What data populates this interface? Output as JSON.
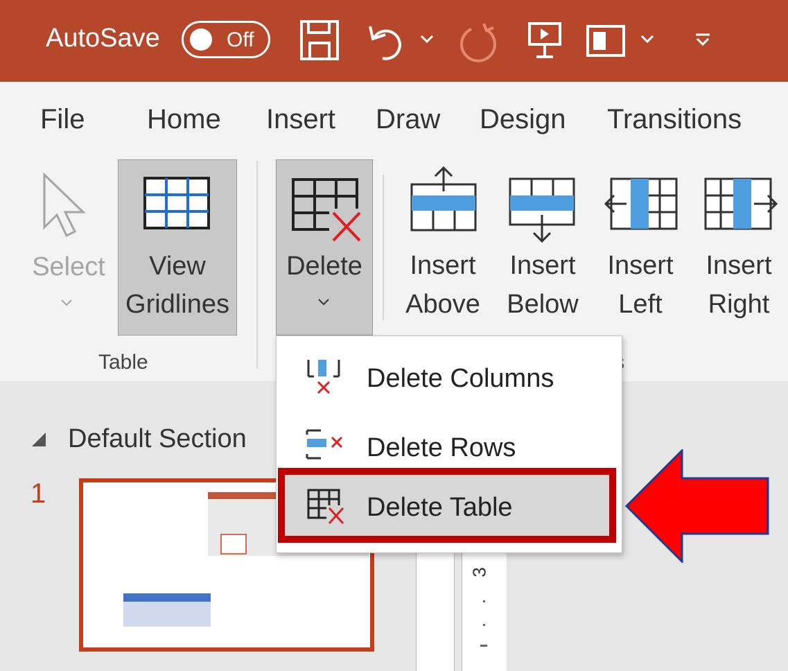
{
  "titlebar": {
    "autosave_label": "AutoSave",
    "autosave_state": "Off",
    "icons": [
      "save-icon",
      "undo-icon",
      "redo-icon",
      "present-icon",
      "layout-icon",
      "customize-icon"
    ],
    "background": "#b7472a"
  },
  "tabs": [
    "File",
    "Home",
    "Insert",
    "Draw",
    "Design",
    "Transitions"
  ],
  "ribbon": {
    "select_label": "Select",
    "view_gridlines_line1": "View",
    "view_gridlines_line2": "Gridlines",
    "table_group": "Table",
    "delete_label": "Delete",
    "insert_above_1": "Insert",
    "insert_above_2": "Above",
    "insert_below_1": "Insert",
    "insert_below_2": "Below",
    "insert_left_1": "Insert",
    "insert_left_2": "Left",
    "insert_right_1": "Insert",
    "insert_right_2": "Right",
    "rows_cols_group_tail": "s"
  },
  "delete_menu": {
    "columns": "Delete Columns",
    "rows": "Delete Rows",
    "table": "Delete Table"
  },
  "slides": {
    "section": "Default Section",
    "slide_number": "1"
  },
  "ruler": {
    "mark": "3"
  },
  "colors": {
    "accent": "#c43e1c",
    "highlight": "#c00000",
    "arrow": "#ff0000",
    "arrow_outline": "#1f3a93"
  }
}
